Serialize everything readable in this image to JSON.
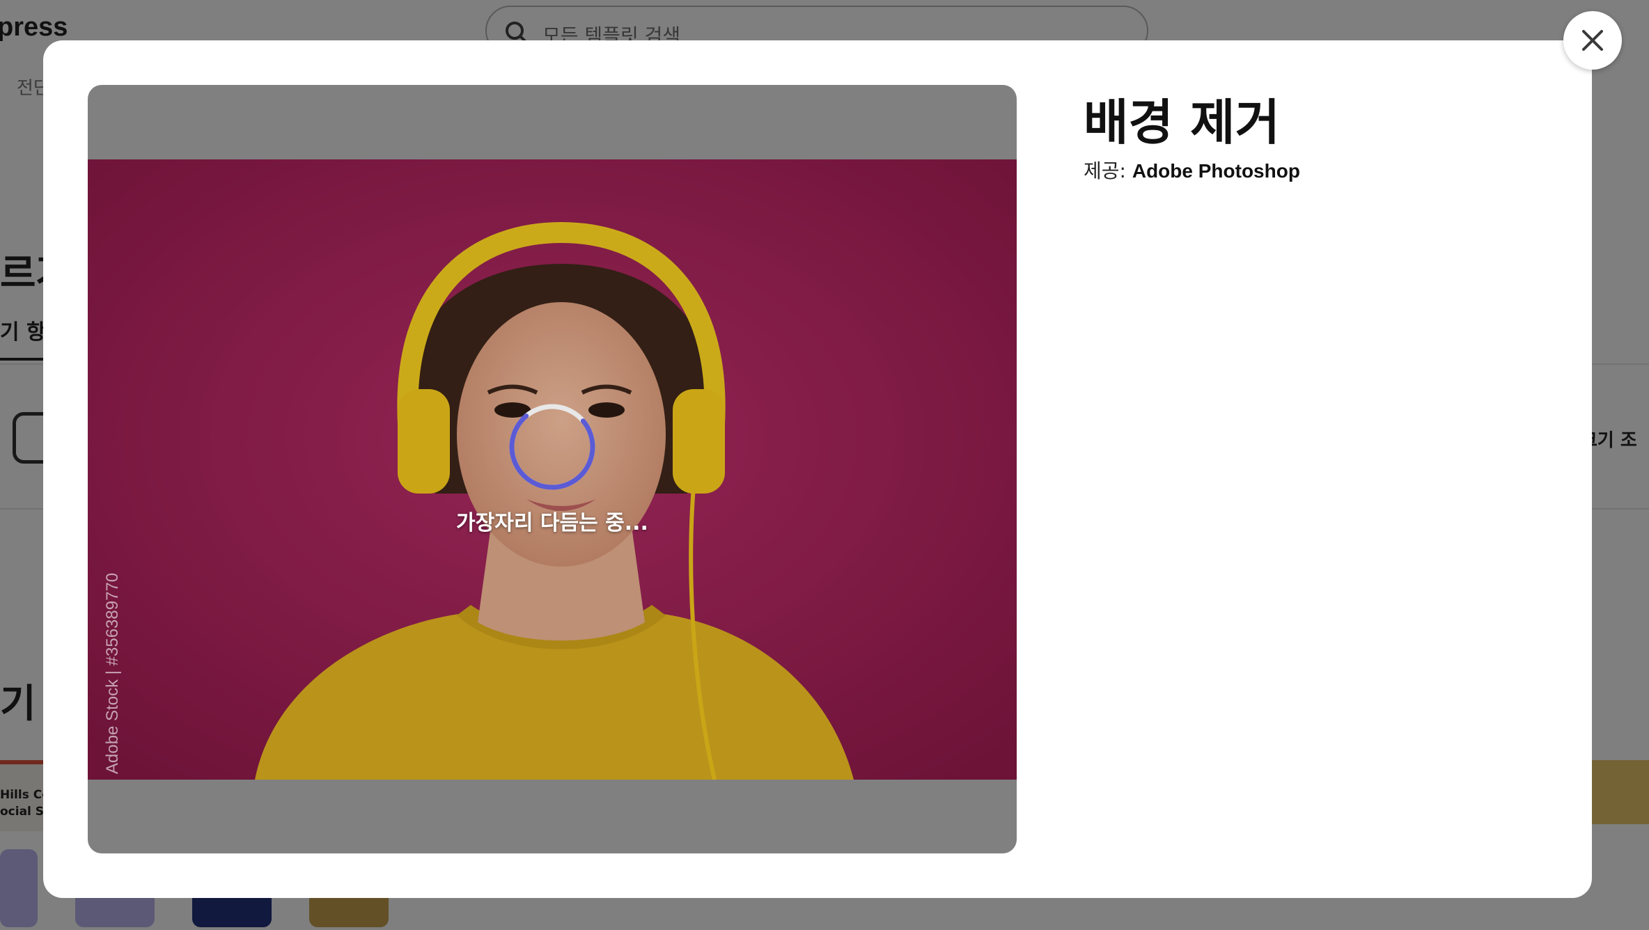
{
  "background": {
    "logo_fragment": "press",
    "search_placeholder": "모든 템플릿 검색",
    "tab_fragment": "전단",
    "heading_fragment": "르거",
    "subtab_fragment": "기 항목",
    "right_fragment": "크기 조",
    "heading2_fragment": "기 템",
    "card_text_line1": "Hills Co",
    "card_text_line2": "ocial Sc"
  },
  "modal": {
    "title": "배경 제거",
    "provider_label": "제공: ",
    "provider_name": "Adobe Photoshop",
    "status_text": "가장자리 다듬는 중...",
    "watermark": "Adobe Stock | #356389770",
    "close_icon": "close-icon"
  },
  "colors": {
    "spinner_accent": "#5b5bd6",
    "photo_background": "#9b1d52"
  }
}
